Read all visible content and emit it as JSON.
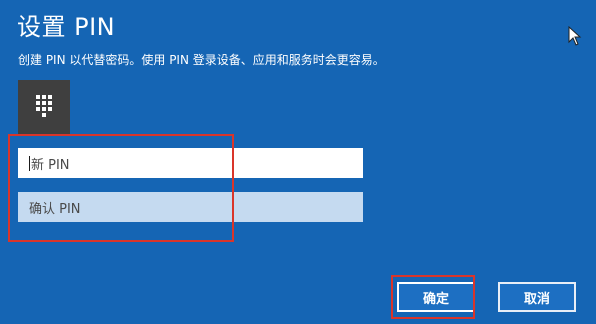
{
  "dialog": {
    "title": "设置 PIN",
    "subtitle": "创建 PIN 以代替密码。使用 PIN 登录设备、应用和服务时会更容易。"
  },
  "fields": {
    "new_pin_placeholder": "新 PIN",
    "confirm_pin_placeholder": "确认 PIN"
  },
  "buttons": {
    "ok_label": "确定",
    "cancel_label": "取消"
  },
  "icons": {
    "keypad": "numeric-keypad-icon",
    "cursor": "mouse-pointer-icon"
  },
  "colors": {
    "background": "#1565b4",
    "tile": "#3f3f3f",
    "annotation": "#d9352a"
  }
}
